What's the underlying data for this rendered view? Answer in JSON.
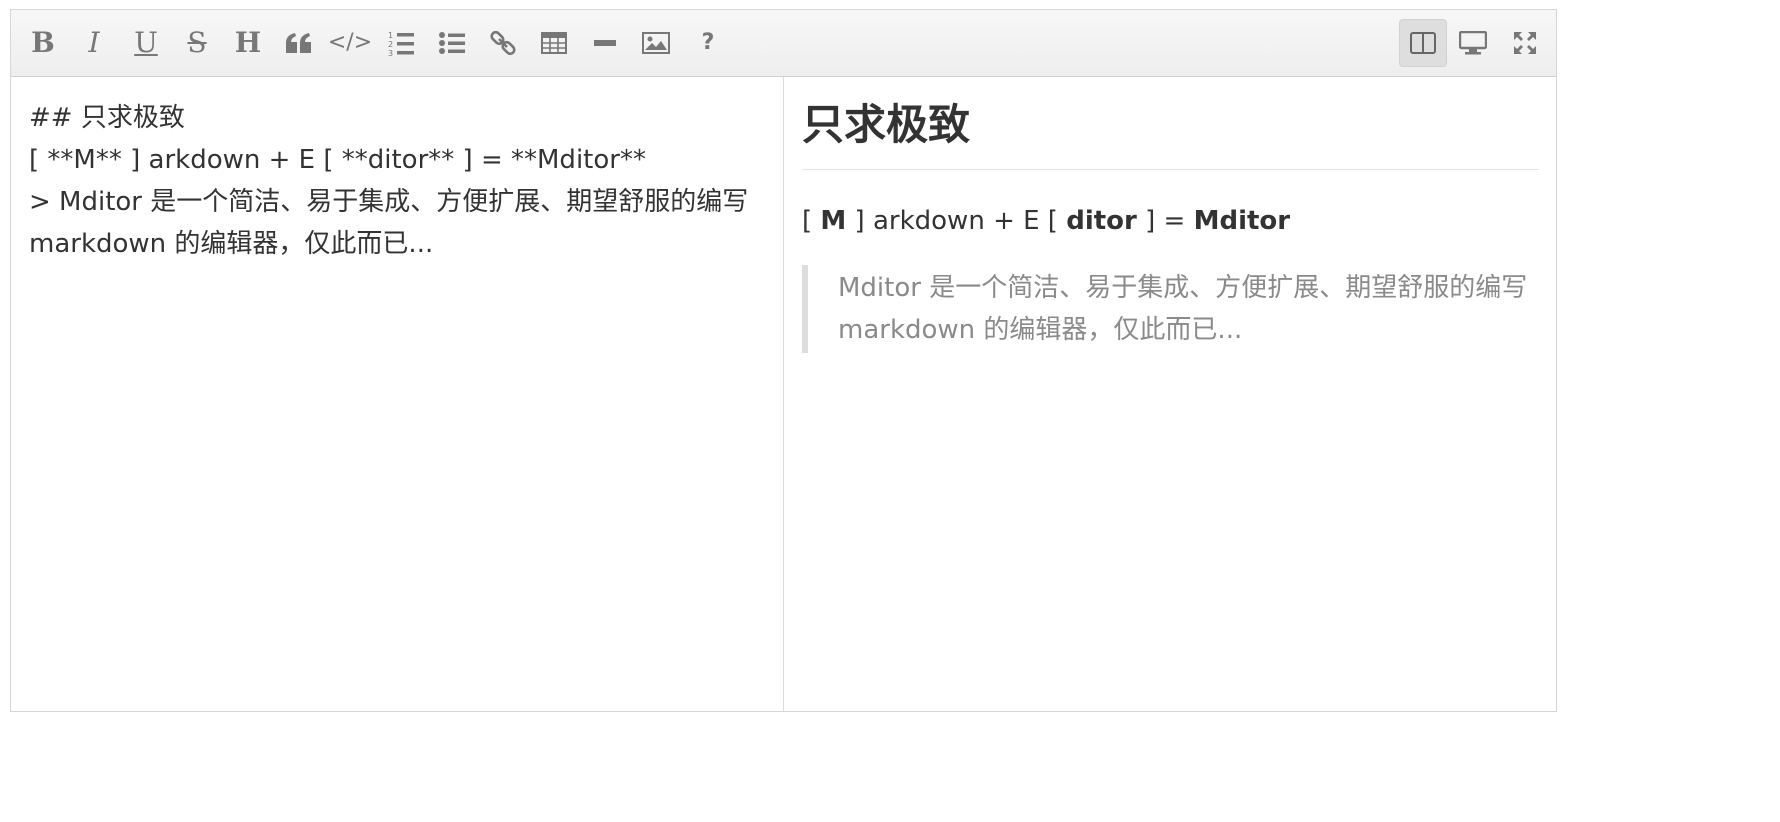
{
  "toolbar": {
    "left_tools": [
      {
        "name": "bold",
        "glyph": "B"
      },
      {
        "name": "italic",
        "glyph": "I"
      },
      {
        "name": "underline",
        "glyph": "U"
      },
      {
        "name": "strikethrough",
        "glyph": "S"
      },
      {
        "name": "heading",
        "glyph": "H"
      },
      {
        "name": "quote",
        "icon": "quote-icon"
      },
      {
        "name": "code",
        "glyph": "</>"
      },
      {
        "name": "ordered-list",
        "icon": "ordered-list-icon"
      },
      {
        "name": "unordered-list",
        "icon": "unordered-list-icon"
      },
      {
        "name": "link",
        "icon": "link-icon"
      },
      {
        "name": "table",
        "icon": "table-icon"
      },
      {
        "name": "horizontal-rule",
        "icon": "horizontal-rule-icon"
      },
      {
        "name": "image",
        "icon": "image-icon"
      },
      {
        "name": "help",
        "glyph": "?"
      }
    ],
    "right_tools": [
      {
        "name": "split-view",
        "icon": "split-view-icon",
        "active": true
      },
      {
        "name": "preview",
        "icon": "monitor-icon",
        "active": false
      },
      {
        "name": "fullscreen",
        "icon": "fullscreen-icon",
        "active": false
      }
    ]
  },
  "source": {
    "lines": [
      "## 只求极致",
      "[ **M** ] arkdown + E [ **ditor** ] = **Mditor**",
      "> Mditor 是一个简洁、易于集成、方便扩展、期望舒服的编写 markdown 的编辑器，仅此而已..."
    ]
  },
  "preview": {
    "heading": "只求极致",
    "para": {
      "p1": "[ ",
      "b1": "M",
      "p2": " ] arkdown + E [ ",
      "b2": "ditor",
      "p3": " ] = ",
      "b3": "Mditor"
    },
    "quote": "Mditor 是一个简洁、易于集成、方便扩展、期望舒服的编写 markdown 的编辑器，仅此而已..."
  },
  "colors": {
    "toolbar_icon": "#777777",
    "text": "#333333",
    "quote_text": "#8a8a8a",
    "quote_border": "#dddddd"
  }
}
